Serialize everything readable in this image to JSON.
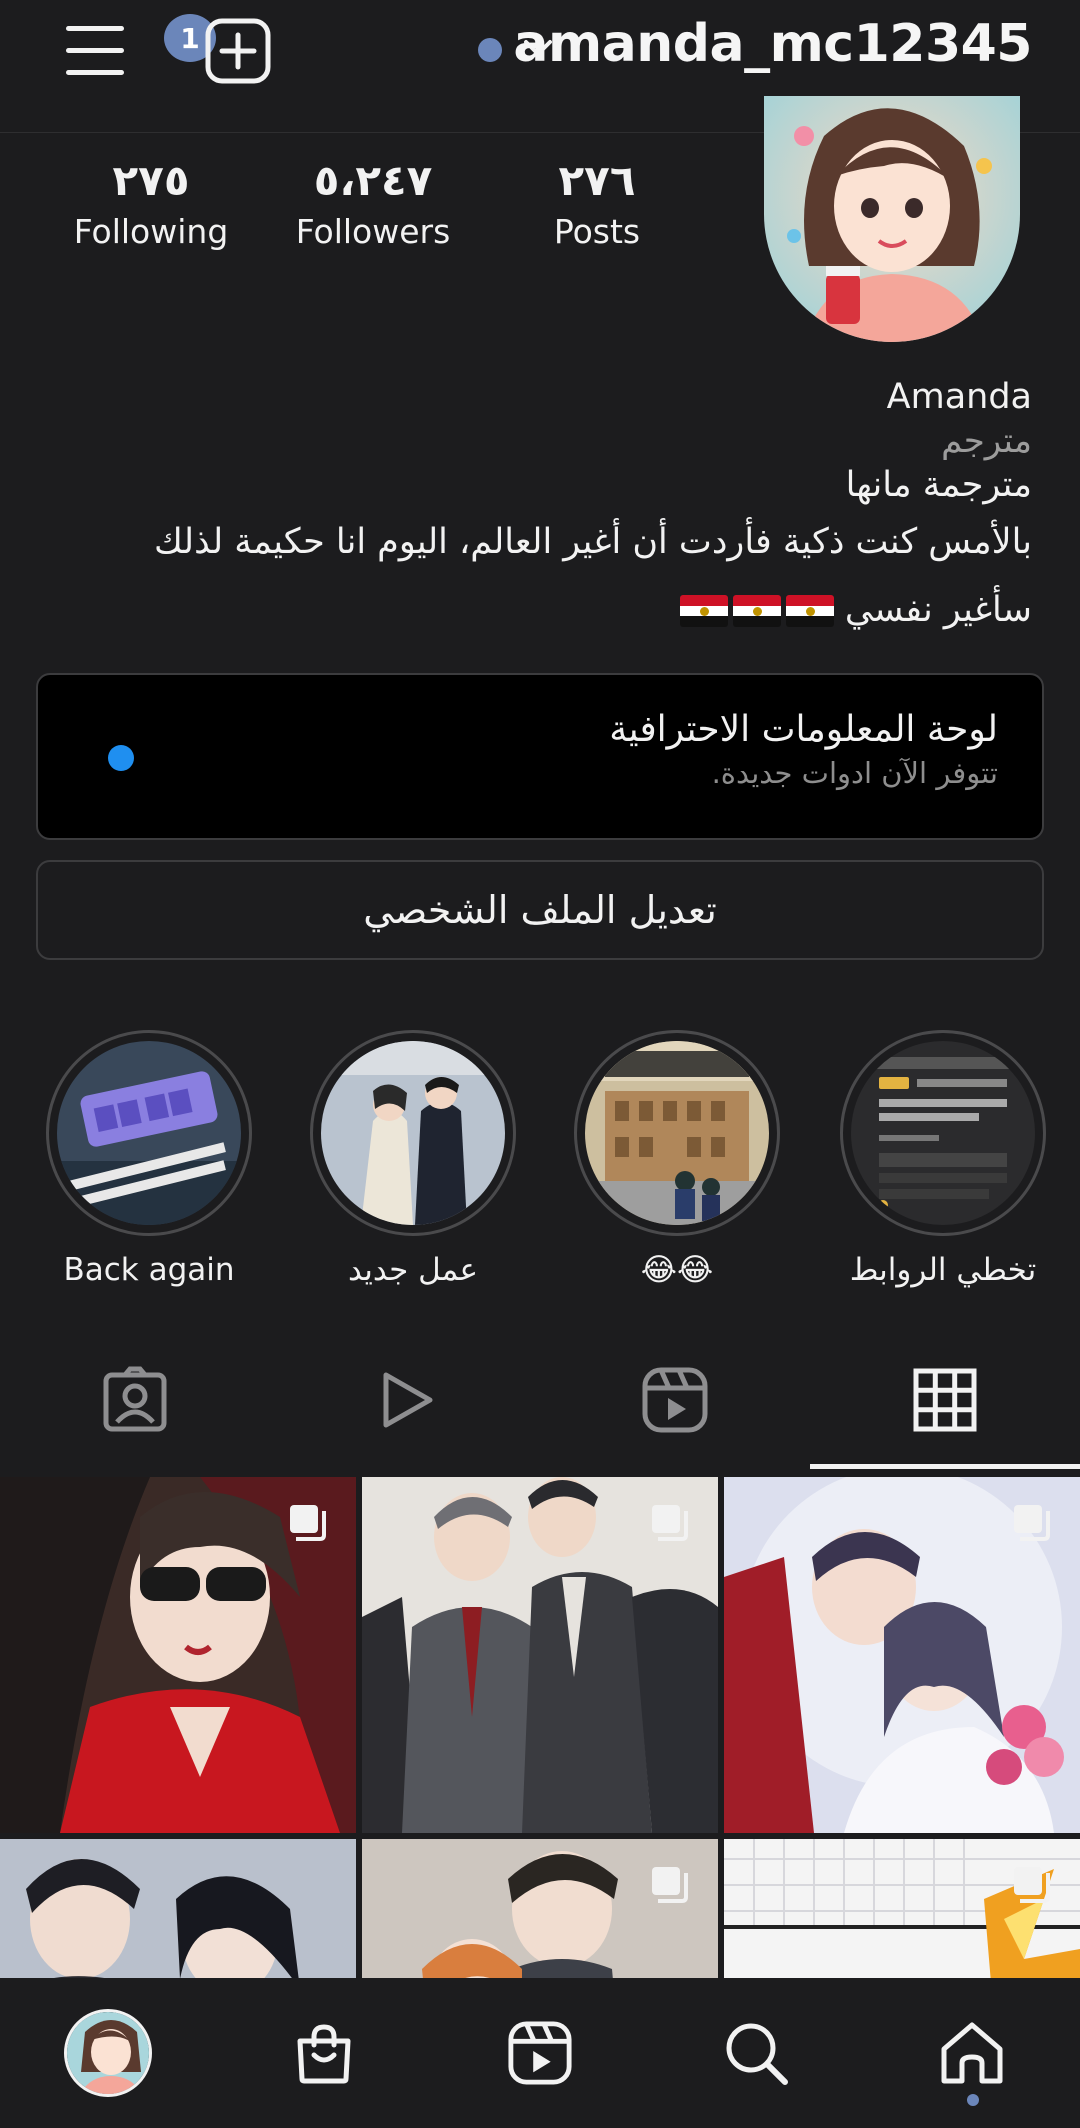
{
  "header": {
    "notification_count": "1",
    "username": "amanda_mc12345"
  },
  "stats": {
    "following": {
      "value": "٢٧٥",
      "label": "Following"
    },
    "followers": {
      "value": "٥،٢٤٧",
      "label": "Followers"
    },
    "posts": {
      "value": "٢٧٦",
      "label": "Posts"
    }
  },
  "bio": {
    "name": "Amanda",
    "category": "مترجم",
    "line1": "مترجمة مانها",
    "line2": "بالأمس كنت ذكية فأردت أن أغير العالم، اليوم انا حكيمة لذلك",
    "line3": "سأغير نفسي"
  },
  "pro_dashboard": {
    "title": "لوحة المعلومات الاحترافية",
    "subtitle": "تتوفر الآن ادوات جديدة."
  },
  "edit_profile_label": "تعديل الملف الشخصي",
  "highlights": [
    {
      "label": "Back again"
    },
    {
      "label": "عمل جديد"
    },
    {
      "label": "😂😂"
    },
    {
      "label": "تخطي الروابط"
    }
  ],
  "tabs": [
    "tagged-icon",
    "video-play-icon",
    "reels-icon",
    "grid-icon"
  ],
  "colors": {
    "background": "#1c1c1e",
    "accent_dot": "#6b86ba",
    "new_tools_dot": "#1f8ff0",
    "pro_box_bg": "#000000"
  }
}
